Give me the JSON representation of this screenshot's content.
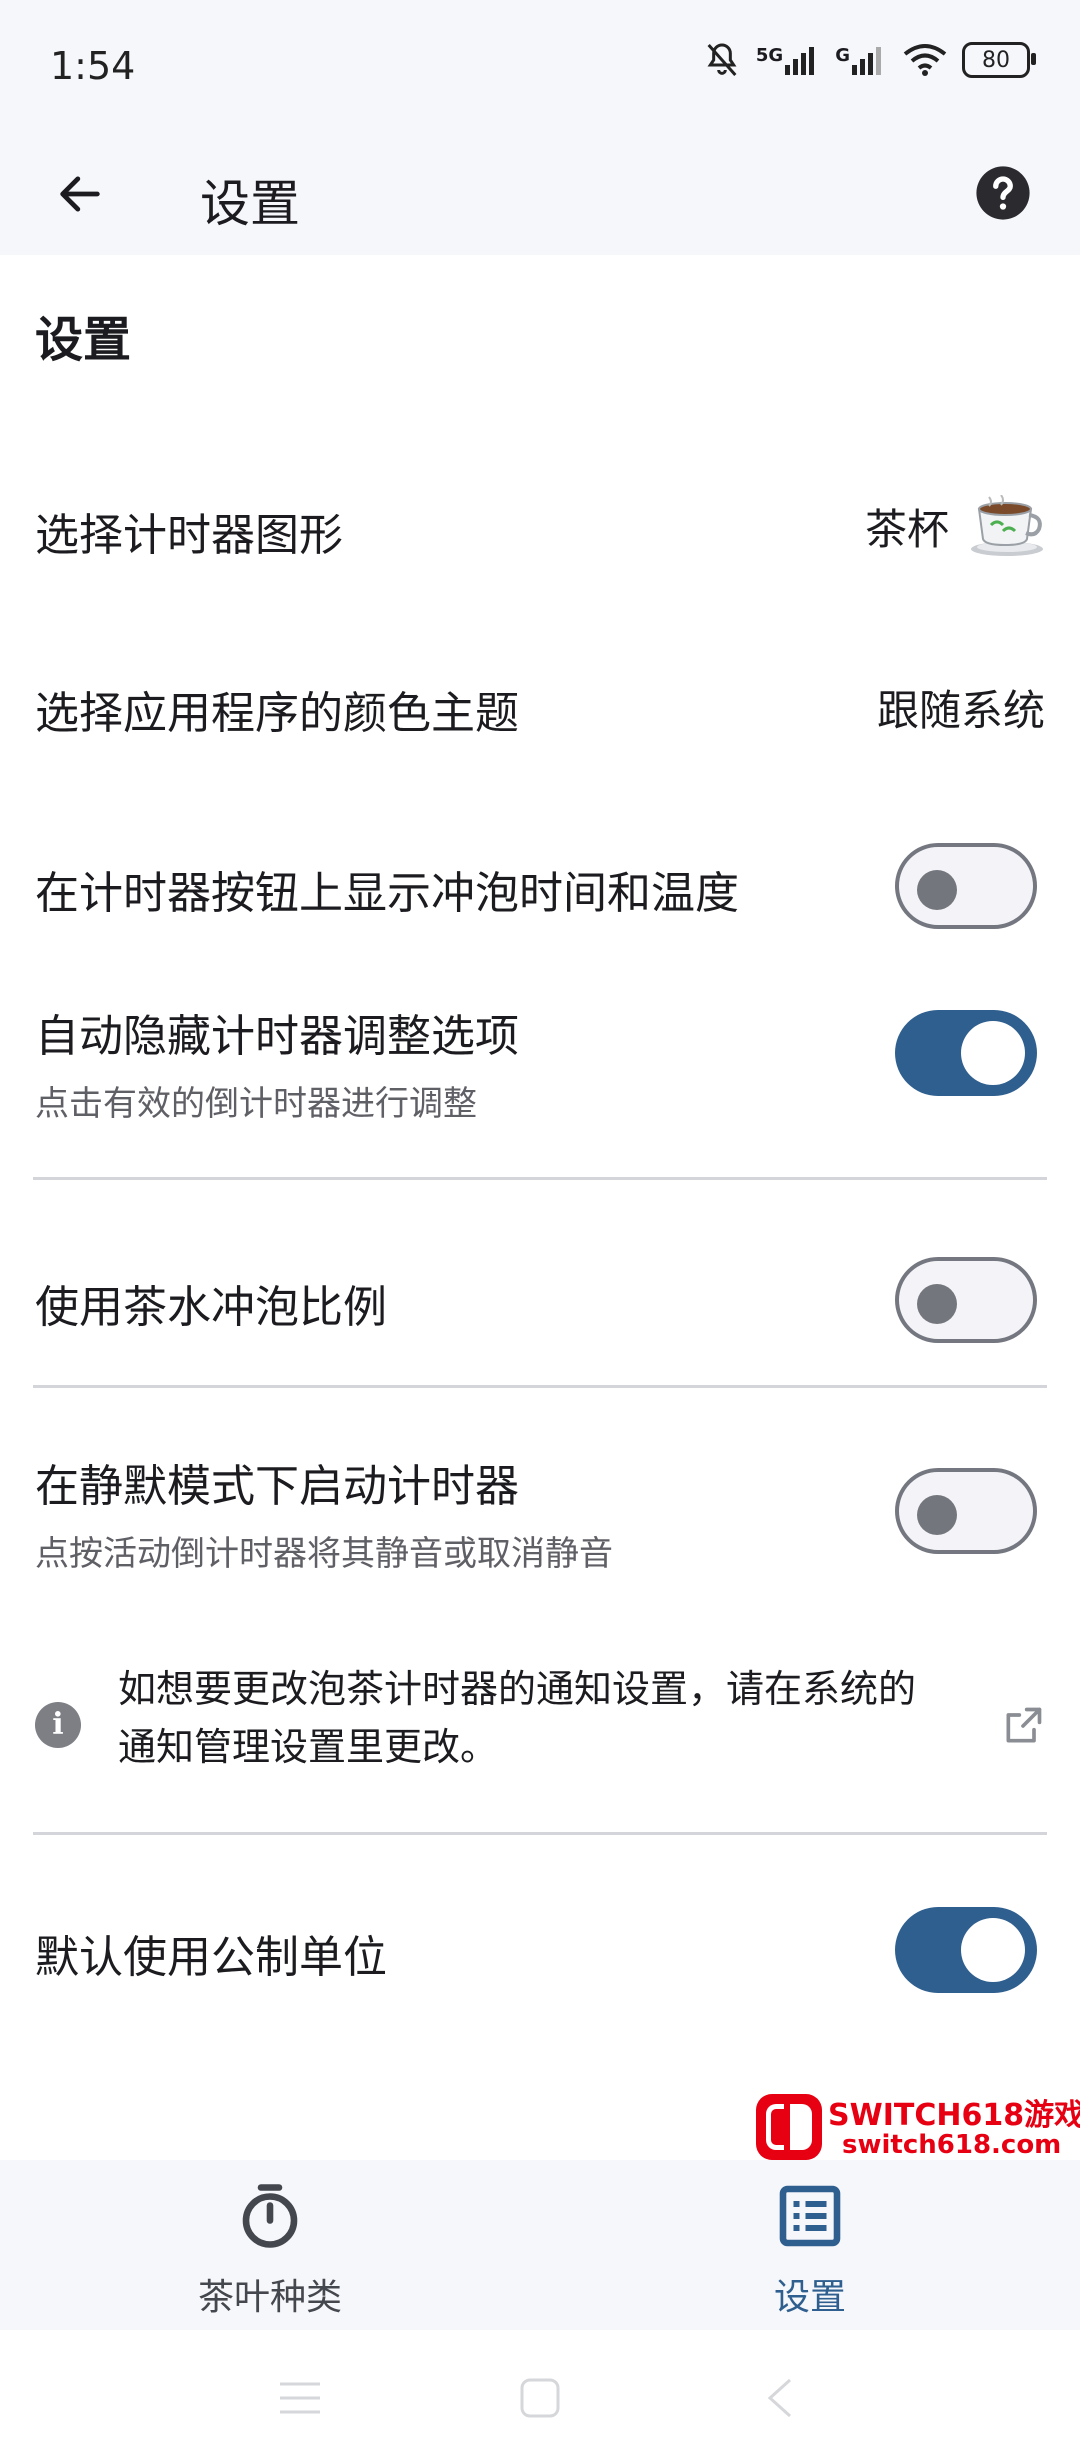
{
  "status": {
    "time": "1:54",
    "network": "5G",
    "network2": "G",
    "battery": "80"
  },
  "appbar": {
    "title": "设置"
  },
  "section": {
    "title": "设置"
  },
  "settings": {
    "timer_shape": {
      "label": "选择计时器图形",
      "value": "茶杯",
      "icon": "teacup-icon"
    },
    "color_theme": {
      "label": "选择应用程序的颜色主题",
      "value": "跟随系统"
    },
    "show_brew_info": {
      "label": "在计时器按钮上显示冲泡时间和温度",
      "enabled": false
    },
    "auto_hide": {
      "label": "自动隐藏计时器调整选项",
      "sublabel": "点击有效的倒计时器进行调整",
      "enabled": true
    },
    "ratio": {
      "label": "使用茶水冲泡比例",
      "enabled": false
    },
    "silent_mode": {
      "label": "在静默模式下启动计时器",
      "sublabel": "点按活动倒计时器将其静音或取消静音",
      "enabled": false
    },
    "notification_info": {
      "line1": "如想要更改泡茶计时器的通知设置，请在系统的",
      "line2": "通知管理设置里更改。"
    },
    "metric": {
      "label": "默认使用公制单位",
      "enabled": true
    }
  },
  "watermark": {
    "title": "SWITCH618游戏",
    "url": "switch618.com"
  },
  "bottom_nav": {
    "tea_label": "茶叶种类",
    "settings_label": "设置"
  },
  "colors": {
    "accent": "#2f5f8f",
    "background": "#ffffff",
    "bar": "#f6f7fb"
  }
}
